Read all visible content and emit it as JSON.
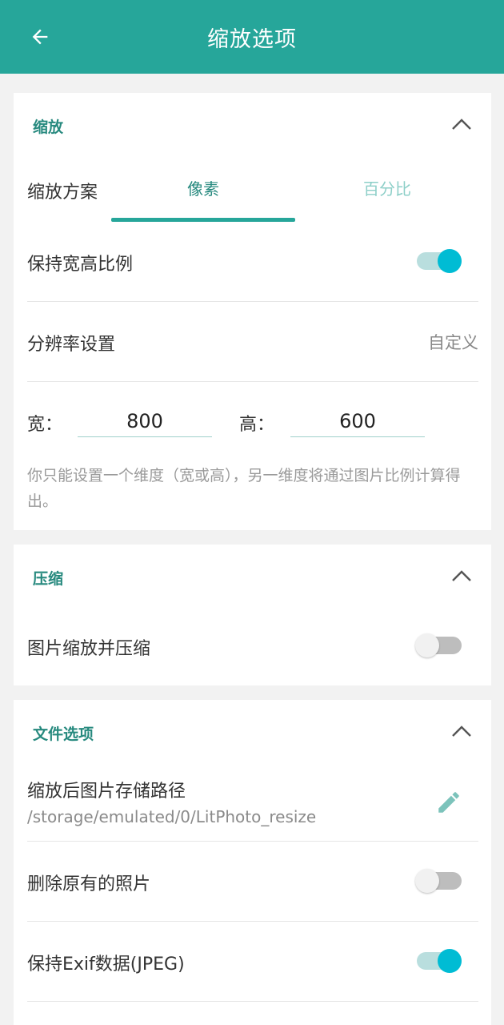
{
  "appbar": {
    "title": "缩放选项",
    "back_icon": "arrow-left-icon"
  },
  "colors": {
    "primary": "#26a69a",
    "section_title": "#26897e",
    "toggle_on": "#00bcd4"
  },
  "scale_section": {
    "title": "缩放",
    "scheme_label": "缩放方案",
    "tabs": [
      {
        "label": "像素",
        "selected": true
      },
      {
        "label": "百分比",
        "selected": false
      }
    ],
    "keep_ratio_label": "保持宽高比例",
    "keep_ratio_on": true,
    "resolution_label": "分辨率设置",
    "resolution_value": "自定义",
    "width_label": "宽：",
    "width_value": "800",
    "height_label": "高：",
    "height_value": "600",
    "hint": "你只能设置一个维度（宽或高），另一维度将通过图片比例计算得出。"
  },
  "compress_section": {
    "title": "压缩",
    "scale_and_compress_label": "图片缩放并压缩",
    "scale_and_compress_on": false
  },
  "file_section": {
    "title": "文件选项",
    "save_path_label": "缩放后图片存储路径",
    "save_path_value": "/storage/emulated/0/LitPhoto_resize",
    "delete_original_label": "删除原有的照片",
    "delete_original_on": false,
    "keep_exif_label": "保持Exif数据(JPEG)",
    "keep_exif_on": true
  }
}
